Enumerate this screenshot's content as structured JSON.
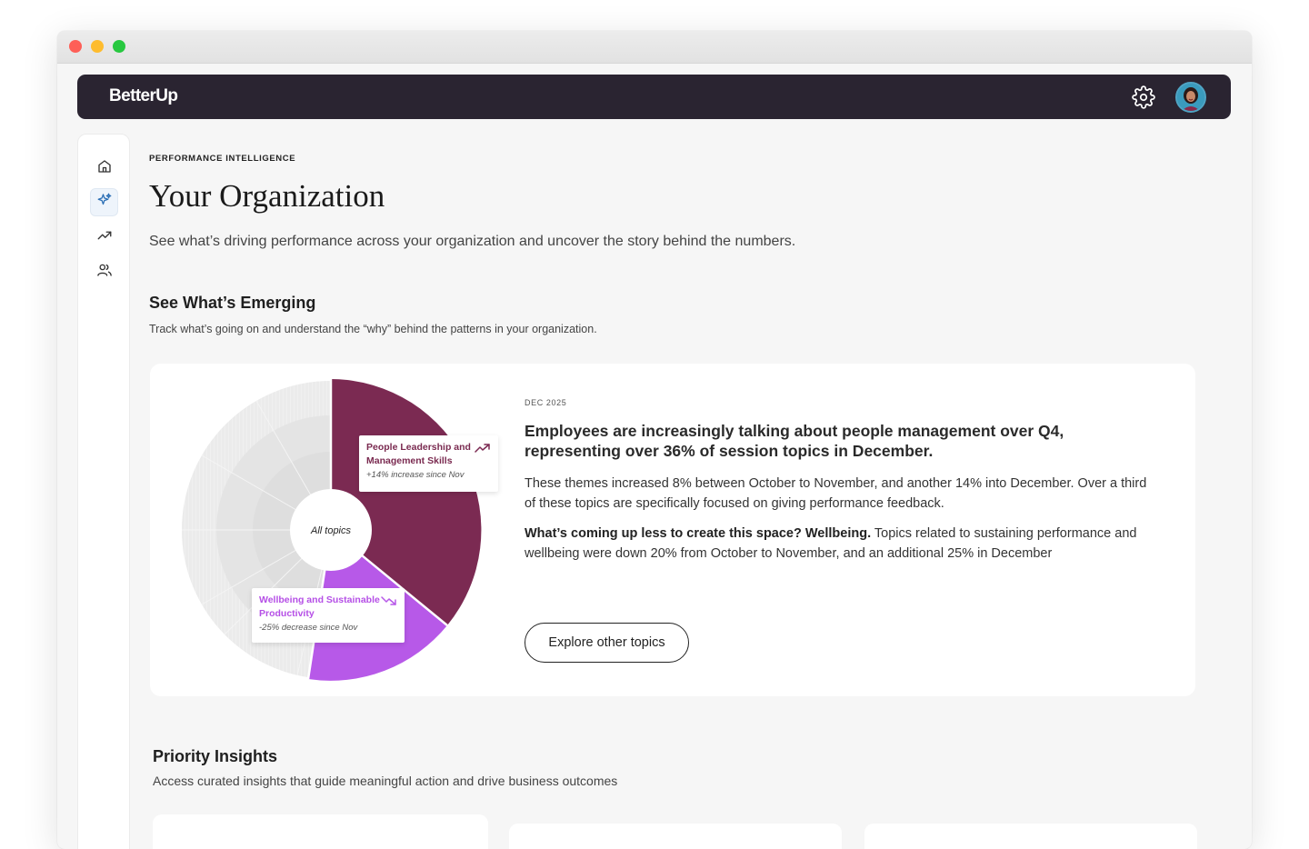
{
  "brand": {
    "logo": "BetterUp"
  },
  "header": {
    "settings_icon": "gear-icon",
    "avatar_icon": "user-avatar"
  },
  "sidebar": {
    "items": [
      {
        "icon": "home-icon"
      },
      {
        "icon": "sparkle-icon",
        "active": true
      },
      {
        "icon": "trending-icon"
      },
      {
        "icon": "people-icon"
      }
    ]
  },
  "page": {
    "eyebrow": "PERFORMANCE INTELLIGENCE",
    "title": "Your Organization",
    "subtitle": "See what’s driving performance across your organization and uncover the story behind the numbers."
  },
  "emerging": {
    "title": "See What’s Emerging",
    "subtitle": "Track what’s going on and understand the “why” behind the patterns in your organization.",
    "chart": {
      "center_label": "All topics",
      "callout_1": {
        "title": "People Leadership and Management Skills",
        "detail": "+14% increase since Nov",
        "trend": "up"
      },
      "callout_2": {
        "title": "Wellbeing and Sustainable Productivity",
        "detail": "-25% decrease since Nov",
        "trend": "down"
      }
    },
    "date": "DEC 2025",
    "headline": "Employees are increasingly talking about people management over Q4, representing over 36% of session topics in December.",
    "paragraph_1": "These themes increased 8% between October to November, and another 14% into December. Over a third of these topics are specifically focused on giving performance feedback.",
    "paragraph_2_bold": "What’s coming up less to create this space? Wellbeing.",
    "paragraph_2_rest": " Topics related to sustaining performance and wellbeing were down 20% from October to November, and an additional 25% in December",
    "button": "Explore other topics",
    "colors": {
      "leadership": "#7b2a52",
      "wellbeing": "#b759e8",
      "other": "#e6e6e6"
    }
  },
  "priority": {
    "title": "Priority Insights",
    "subtitle": "Access curated insights that guide meaningful action and drive business outcomes"
  }
}
